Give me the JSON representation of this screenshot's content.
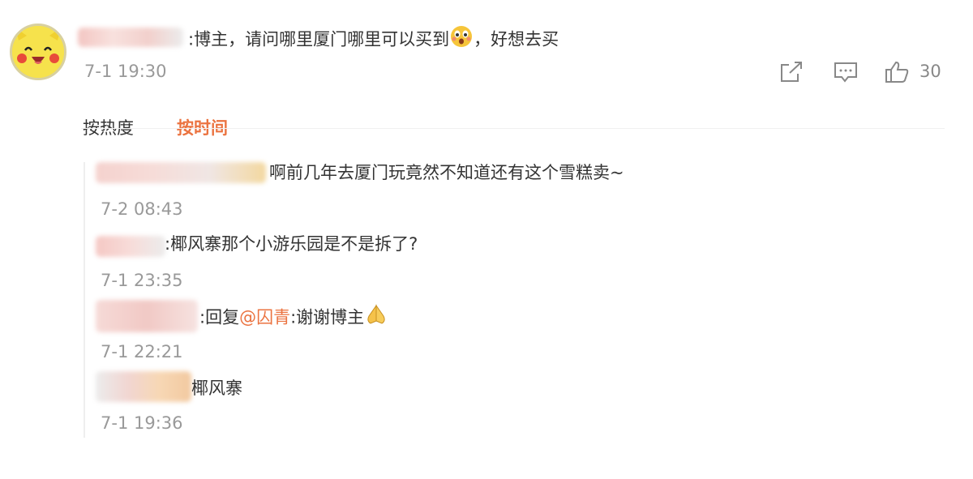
{
  "comment": {
    "text_prefix": ":博主，请问哪里厦门哪里可以买到",
    "text_suffix": "，好想去买",
    "timestamp": "7-1 19:30",
    "actions": {
      "share_icon": "share-icon",
      "reply_icon": "comment-icon",
      "like_icon": "thumbs-up-icon",
      "like_count": "30"
    }
  },
  "sort_tabs": [
    {
      "label": "按热度",
      "active": false
    },
    {
      "label": "按时间",
      "active": true
    }
  ],
  "replies": [
    {
      "text": "啊前几年去厦门玩竟然不知道还有这个雪糕卖~",
      "timestamp": "7-2 08:43"
    },
    {
      "text": ":椰风寨那个小游乐园是不是拆了?",
      "timestamp": "7-1 23:35"
    },
    {
      "text_prefix": ":回复",
      "mention": "@囚青",
      "text_suffix": ":谢谢博主",
      "timestamp": "7-1 22:21"
    },
    {
      "text": "椰风寨",
      "timestamp": "7-1 19:36"
    }
  ],
  "colors": {
    "accent": "#eb7340",
    "muted": "#999999",
    "text": "#333333"
  }
}
